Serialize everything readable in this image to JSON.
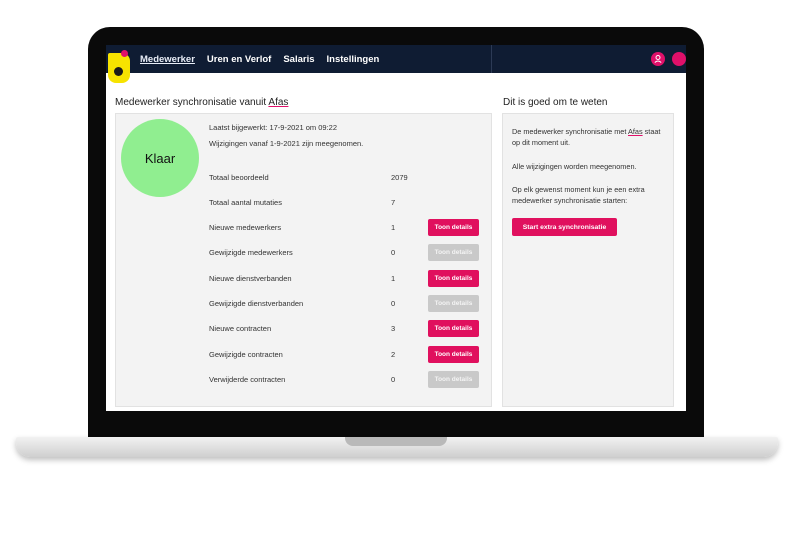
{
  "nav": {
    "items": [
      {
        "label": "Medewerker",
        "active": true
      },
      {
        "label": "Uren en Verlof"
      },
      {
        "label": "Salaris"
      },
      {
        "label": "Instellingen"
      }
    ],
    "user_icon": "user-icon",
    "accent": "#e0106a",
    "background": "#0f1c33"
  },
  "main": {
    "title_prefix": "Medewerker synchronisatie vanuit",
    "title_link": "Afas",
    "status": {
      "label": "Klaar",
      "color": "#90ee90"
    },
    "last_updated": "Laatst bijgewerkt: 17-9-2021 om 09:22",
    "changes_since": "Wijzigingen vanaf 1-9-2021 zijn meegenomen.",
    "rows": [
      {
        "label": "Totaal beoordeeld",
        "value": "2079"
      },
      {
        "label": "Totaal aantal mutaties",
        "value": "7"
      },
      {
        "label": "Nieuwe medewerkers",
        "value": "1",
        "button": "Toon details",
        "enabled": true
      },
      {
        "label": "Gewijzigde medewerkers",
        "value": "0",
        "button": "Toon details",
        "enabled": false
      },
      {
        "label": "Nieuwe dienstverbanden",
        "value": "1",
        "button": "Toon details",
        "enabled": true
      },
      {
        "label": "Gewijzigde dienstverbanden",
        "value": "0",
        "button": "Toon details",
        "enabled": false
      },
      {
        "label": "Nieuwe contracten",
        "value": "3",
        "button": "Toon details",
        "enabled": true
      },
      {
        "label": "Gewijzigde contracten",
        "value": "2",
        "button": "Toon details",
        "enabled": true
      },
      {
        "label": "Verwijderde contracten",
        "value": "0",
        "button": "Toon details",
        "enabled": false
      }
    ]
  },
  "side": {
    "title": "Dit is goed om te weten",
    "p1_prefix": "De medewerker synchronisatie met",
    "p1_link": "Afas",
    "p1_suffix": "staat op dit moment uit.",
    "p2": "Alle wijzigingen worden meegenomen.",
    "p3": "Op elk gewenst moment kun je een extra medewerker synchronisatie starten:",
    "button": "Start extra synchronisatie"
  }
}
